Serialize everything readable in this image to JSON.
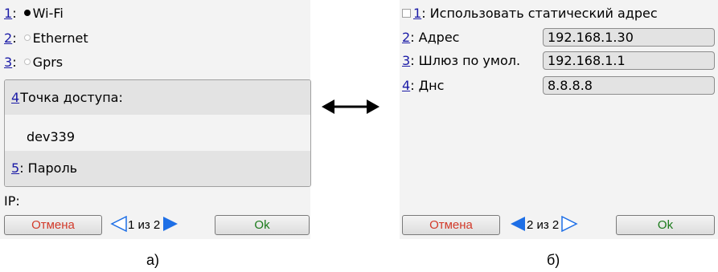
{
  "screen_a": {
    "connection_options": [
      {
        "num": "1",
        "label": "Wi-Fi",
        "selected": true
      },
      {
        "num": "2",
        "label": "Ethernet",
        "selected": false
      },
      {
        "num": "3",
        "label": "Gprs",
        "selected": false
      }
    ],
    "access_point": {
      "num": "4",
      "label": "Точка доступа:",
      "value": "dev339"
    },
    "password": {
      "num": "5",
      "label": "Пароль"
    },
    "ip_label": "IP:",
    "cancel_label": "Отмена",
    "ok_label": "Ok",
    "pager_text": "1 из 2"
  },
  "arrow": {
    "icon": "double-arrow-icon"
  },
  "screen_b": {
    "static_checkbox": {
      "num": "1",
      "label": "Использовать статический адрес",
      "checked": false
    },
    "fields": [
      {
        "num": "2",
        "label": "Адрес",
        "value": "192.168.1.30"
      },
      {
        "num": "3",
        "label": "Шлюз по умол.",
        "value": "192.168.1.1"
      },
      {
        "num": "4",
        "label": "Днс",
        "value": "8.8.8.8"
      }
    ],
    "cancel_label": "Отмена",
    "ok_label": "Ok",
    "pager_text": "2 из 2"
  },
  "captions": {
    "a": "а)",
    "b": "б)"
  },
  "colors": {
    "accent_blue": "#1e6fe6",
    "cancel_red": "#d23a2a",
    "ok_green": "#1a7a1a",
    "link_blue": "#1a1aa6"
  }
}
